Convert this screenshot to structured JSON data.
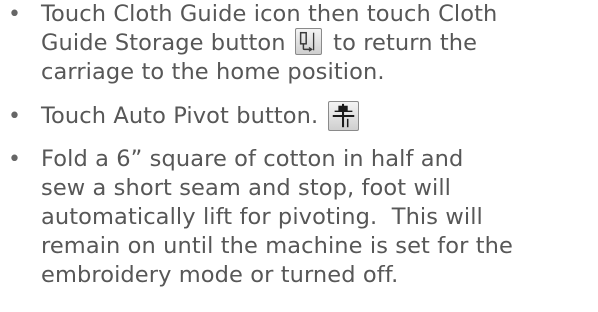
{
  "instructions": {
    "bullet_symbol": "•",
    "items": [
      {
        "lines": [
          "Touch Cloth Guide icon then touch Cloth",
          "Guide Storage button",
          "to return the",
          "carriage to the home position."
        ]
      },
      {
        "lines": [
          "Touch Auto Pivot button."
        ]
      },
      {
        "lines": [
          "Fold a 6” square of cotton in half and",
          "sew a short seam and stop, foot will",
          "automatically lift for pivoting.  This will",
          "remain on until the machine is set for the",
          "embroidery mode or turned off."
        ]
      }
    ]
  },
  "icons": {
    "storage_icon": "cloth-guide-storage-icon",
    "pivot_icon": "auto-pivot-icon"
  }
}
